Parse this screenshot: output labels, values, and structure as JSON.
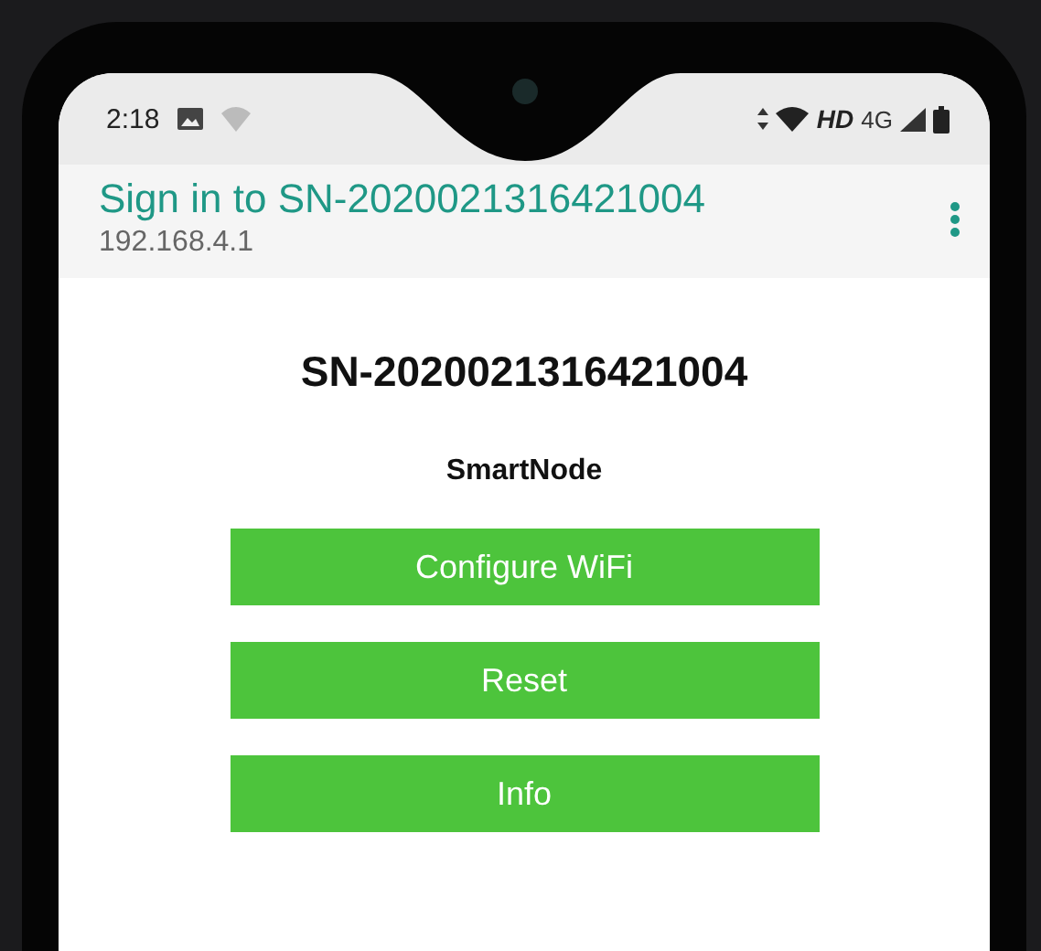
{
  "status_bar": {
    "time": "2:18",
    "network_label": "HD",
    "network_type": "4G"
  },
  "app_bar": {
    "title": "Sign in to SN-2020021316421004",
    "address": "192.168.4.1"
  },
  "page": {
    "heading": "SN-2020021316421004",
    "subtitle": "SmartNode",
    "buttons": [
      "Configure WiFi",
      "Reset",
      "Info"
    ]
  }
}
